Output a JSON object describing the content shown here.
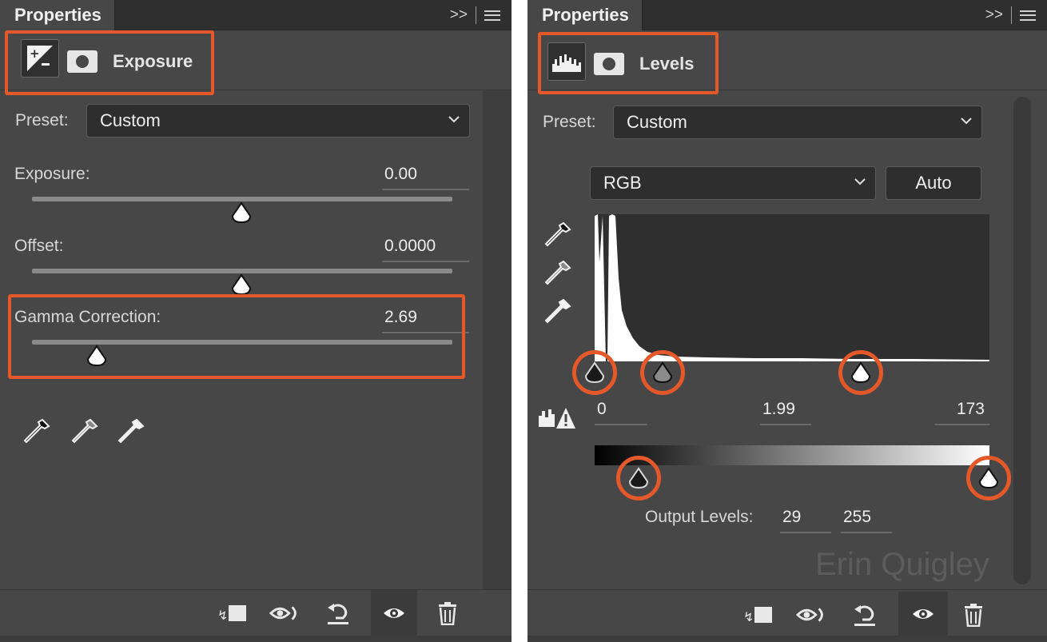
{
  "left_panel": {
    "tab_label": "Properties",
    "collapse_label": ">>",
    "adjustment_title": "Exposure",
    "preset_label": "Preset:",
    "preset_value": "Custom",
    "exposure_label": "Exposure:",
    "exposure_value": "0.00",
    "exposure_level": 0.5,
    "offset_label": "Offset:",
    "offset_value": "0.0000",
    "offset_level": 0.5,
    "gamma_label": "Gamma Correction:",
    "gamma_value": "2.69",
    "gamma_level": 0.15,
    "eyedroppers": [
      "black-point-eyedropper-icon",
      "gray-point-eyedropper-icon",
      "white-point-eyedropper-icon"
    ],
    "footer_icons": [
      "clip-to-layer-icon",
      "view-previous-state-icon",
      "reset-icon",
      "visibility-eye-icon",
      "trash-icon"
    ]
  },
  "right_panel": {
    "tab_label": "Properties",
    "collapse_label": ">>",
    "adjustment_title": "Levels",
    "preset_label": "Preset:",
    "preset_value": "Custom",
    "channel_value": "RGB",
    "auto_label": "Auto",
    "input_black": "0",
    "input_gamma": "1.99",
    "input_white": "173",
    "output_label": "Output Levels:",
    "output_black": "29",
    "output_white": "255",
    "watermark": "Erin Quigley"
  },
  "colors": {
    "highlight": "#e4582a",
    "panel_bg": "#474747",
    "tab_bar_bg": "#2f2f2f"
  }
}
